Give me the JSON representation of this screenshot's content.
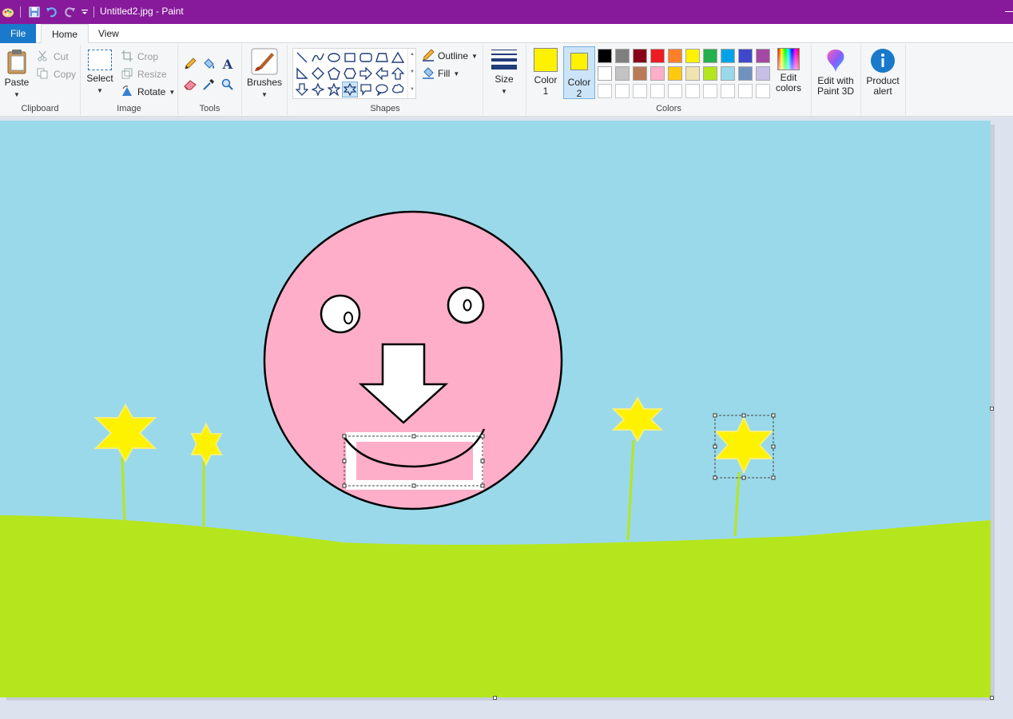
{
  "window": {
    "title": "Untitled2.jpg - Paint"
  },
  "quick_access": {
    "app_icon": "paint-palette-icon",
    "save_icon": "save-icon",
    "undo_icon": "undo-icon",
    "redo_icon": "redo-icon",
    "customize_icon": "dropdown-icon"
  },
  "tabs": {
    "file": "File",
    "home": "Home",
    "view": "View"
  },
  "clipboard": {
    "paste": "Paste",
    "cut": "Cut",
    "copy": "Copy",
    "group": "Clipboard"
  },
  "image": {
    "select": "Select",
    "crop": "Crop",
    "resize": "Resize",
    "rotate": "Rotate",
    "group": "Image"
  },
  "tools": {
    "group": "Tools",
    "items": [
      "pencil-icon",
      "fill-icon",
      "text-icon",
      "eraser-icon",
      "color-picker-icon",
      "magnifier-icon"
    ]
  },
  "brushes": {
    "label": "Brushes"
  },
  "shapes": {
    "outline": "Outline",
    "fill": "Fill",
    "group": "Shapes",
    "selected": "six-point-star"
  },
  "size": {
    "label": "Size"
  },
  "colors": {
    "color1_line1": "Color",
    "color1_line2": "1",
    "color2_line1": "Color",
    "color2_line2": "2",
    "color1": "#fff200",
    "color2": "#fff200",
    "edit_line1": "Edit",
    "edit_line2": "colors",
    "group": "Colors",
    "palette_row1": [
      "#000000",
      "#7f7f7f",
      "#880015",
      "#ed1c24",
      "#ff7f27",
      "#fff200",
      "#22b14c",
      "#00a2e8",
      "#3f48cc",
      "#a349a4"
    ],
    "palette_row2": [
      "#ffffff",
      "#c3c3c3",
      "#b97a57",
      "#ffaec9",
      "#ffc90e",
      "#efe4b0",
      "#b5e61d",
      "#99d9ea",
      "#7092be",
      "#c8bfe7"
    ],
    "palette_row3": [
      "#ffffff",
      "#ffffff",
      "#ffffff",
      "#ffffff",
      "#ffffff",
      "#ffffff",
      "#ffffff",
      "#ffffff",
      "#ffffff",
      "#ffffff"
    ]
  },
  "paint3d": {
    "line1": "Edit with",
    "line2": "Paint 3D"
  },
  "alert": {
    "line1": "Product",
    "line2": "alert"
  },
  "canvas": {
    "sky": "#9ad9ea",
    "grass": "#b5e61d",
    "face": "#ffaec9",
    "star": "#fff200"
  }
}
